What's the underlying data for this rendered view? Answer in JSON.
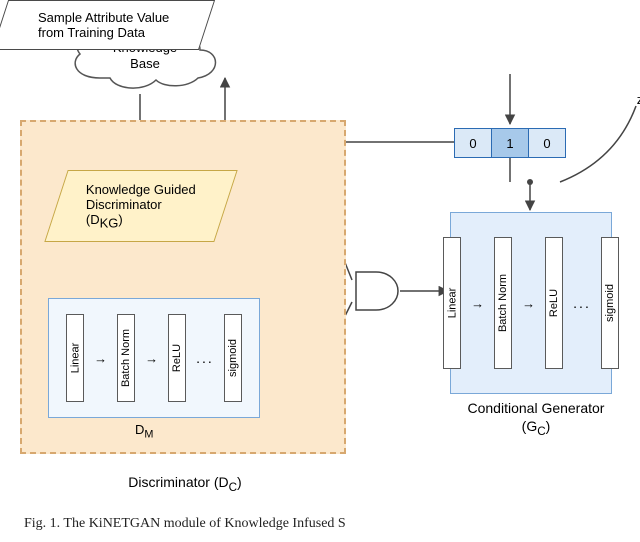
{
  "knowledge_base": {
    "label": "Knowledge\nBase"
  },
  "sample_block": {
    "label": "Sample Attribute Value\nfrom Training Data"
  },
  "noise_label": "z",
  "onehot": {
    "v0": "0",
    "v1": "1",
    "v2": "0"
  },
  "kg_disc": {
    "line1": "Knowledge Guided",
    "line2": "Discriminator",
    "line3": "(D",
    "sub": "KG",
    "line3b": ")"
  },
  "layers": {
    "linear": "Linear",
    "batchnorm": "Batch Norm",
    "relu": "ReLU",
    "sigmoid": "sigmoid",
    "dots": "..."
  },
  "dm_label": {
    "text": "D",
    "sub": "M"
  },
  "disc_group_label": {
    "text": "Discriminator (D",
    "sub": "C",
    "tail": ")"
  },
  "gen_label": {
    "text": "Conditional Generator",
    "subline": "(G",
    "sub": "C",
    "tail": ")"
  },
  "caption": "Fig. 1.  The KiNETGAN module of Knowledge Infused S"
}
